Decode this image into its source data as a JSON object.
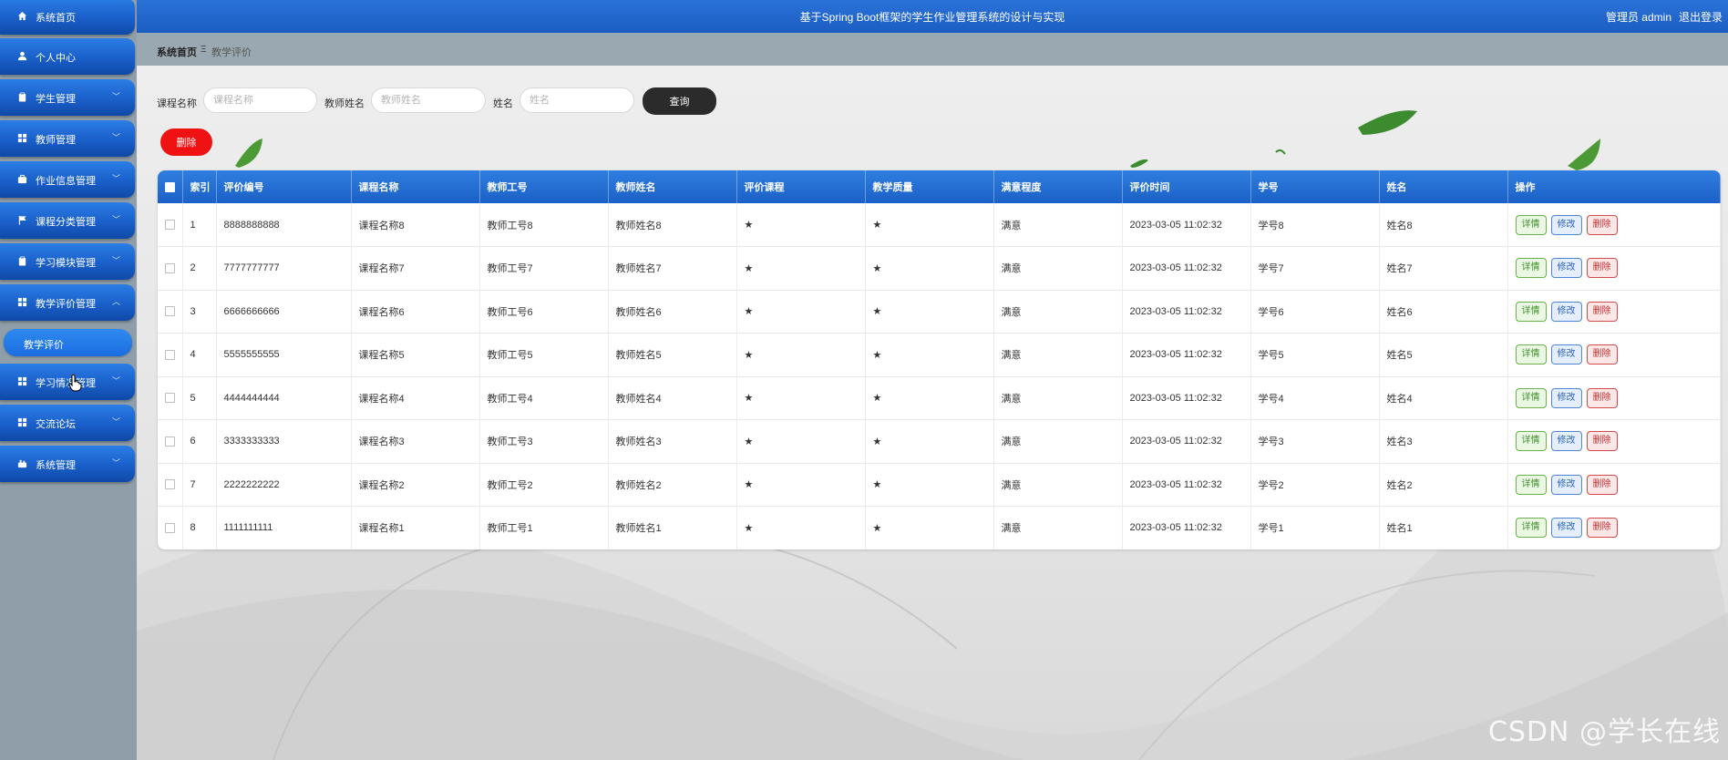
{
  "sidebar": {
    "items": [
      {
        "label": "系统首页",
        "icon": "home-icon"
      },
      {
        "label": "个人中心",
        "icon": "user-icon"
      },
      {
        "label": "学生管理",
        "icon": "clipboard-icon"
      },
      {
        "label": "教师管理",
        "icon": "grid-icon"
      },
      {
        "label": "作业信息管理",
        "icon": "briefcase-icon"
      },
      {
        "label": "课程分类管理",
        "icon": "flag-icon"
      },
      {
        "label": "学习模块管理",
        "icon": "clipboard-icon"
      },
      {
        "label": "教学评价管理",
        "icon": "grid-icon"
      },
      {
        "label": "学习情况管理",
        "icon": "grid-icon"
      },
      {
        "label": "交流论坛",
        "icon": "grid-icon"
      },
      {
        "label": "系统管理",
        "icon": "settings-icon"
      }
    ],
    "sub_item": "教学评价"
  },
  "header": {
    "title": "基于Spring Boot框架的学生作业管理系统的设计与实现",
    "user": "管理员 admin",
    "logout": "退出登录"
  },
  "breadcrumb": {
    "home": "系统首页",
    "separator": "Ξ",
    "current": "教学评价"
  },
  "search": {
    "course_label": "课程名称",
    "course_placeholder": "课程名称",
    "teacher_label": "教师姓名",
    "teacher_placeholder": "教师姓名",
    "name_label": "姓名",
    "name_placeholder": "姓名",
    "query_button": "查询"
  },
  "actions": {
    "delete_button": "删除"
  },
  "table": {
    "columns": [
      "",
      "索引",
      "评价编号",
      "课程名称",
      "教师工号",
      "教师姓名",
      "评价课程",
      "教学质量",
      "满意程度",
      "评价时间",
      "学号",
      "姓名",
      "操作"
    ],
    "rows": [
      {
        "index": "1",
        "code": "8888888888",
        "course": "课程名称8",
        "teacher_no": "教师工号8",
        "teacher_name": "教师姓名8",
        "rate_course": "★",
        "quality": "★",
        "satisfaction": "满意",
        "time": "2023-03-05 11:02:32",
        "student_no": "学号8",
        "name": "姓名8"
      },
      {
        "index": "2",
        "code": "7777777777",
        "course": "课程名称7",
        "teacher_no": "教师工号7",
        "teacher_name": "教师姓名7",
        "rate_course": "★",
        "quality": "★",
        "satisfaction": "满意",
        "time": "2023-03-05 11:02:32",
        "student_no": "学号7",
        "name": "姓名7"
      },
      {
        "index": "3",
        "code": "6666666666",
        "course": "课程名称6",
        "teacher_no": "教师工号6",
        "teacher_name": "教师姓名6",
        "rate_course": "★",
        "quality": "★",
        "satisfaction": "满意",
        "time": "2023-03-05 11:02:32",
        "student_no": "学号6",
        "name": "姓名6"
      },
      {
        "index": "4",
        "code": "5555555555",
        "course": "课程名称5",
        "teacher_no": "教师工号5",
        "teacher_name": "教师姓名5",
        "rate_course": "★",
        "quality": "★",
        "satisfaction": "满意",
        "time": "2023-03-05 11:02:32",
        "student_no": "学号5",
        "name": "姓名5"
      },
      {
        "index": "5",
        "code": "4444444444",
        "course": "课程名称4",
        "teacher_no": "教师工号4",
        "teacher_name": "教师姓名4",
        "rate_course": "★",
        "quality": "★",
        "satisfaction": "满意",
        "time": "2023-03-05 11:02:32",
        "student_no": "学号4",
        "name": "姓名4"
      },
      {
        "index": "6",
        "code": "3333333333",
        "course": "课程名称3",
        "teacher_no": "教师工号3",
        "teacher_name": "教师姓名3",
        "rate_course": "★",
        "quality": "★",
        "satisfaction": "满意",
        "time": "2023-03-05 11:02:32",
        "student_no": "学号3",
        "name": "姓名3"
      },
      {
        "index": "7",
        "code": "2222222222",
        "course": "课程名称2",
        "teacher_no": "教师工号2",
        "teacher_name": "教师姓名2",
        "rate_course": "★",
        "quality": "★",
        "satisfaction": "满意",
        "time": "2023-03-05 11:02:32",
        "student_no": "学号2",
        "name": "姓名2"
      },
      {
        "index": "8",
        "code": "1111111111",
        "course": "课程名称1",
        "teacher_no": "教师工号1",
        "teacher_name": "教师姓名1",
        "rate_course": "★",
        "quality": "★",
        "satisfaction": "满意",
        "time": "2023-03-05 11:02:32",
        "student_no": "学号1",
        "name": "姓名1"
      }
    ],
    "row_actions": {
      "detail": "详情",
      "edit": "修改",
      "delete": "删除"
    }
  },
  "watermark": "CSDN @学长在线",
  "colors": {
    "header_blue": "#1c5dc2",
    "delete_red": "#f01212",
    "query_dark": "#2b2b2b"
  }
}
